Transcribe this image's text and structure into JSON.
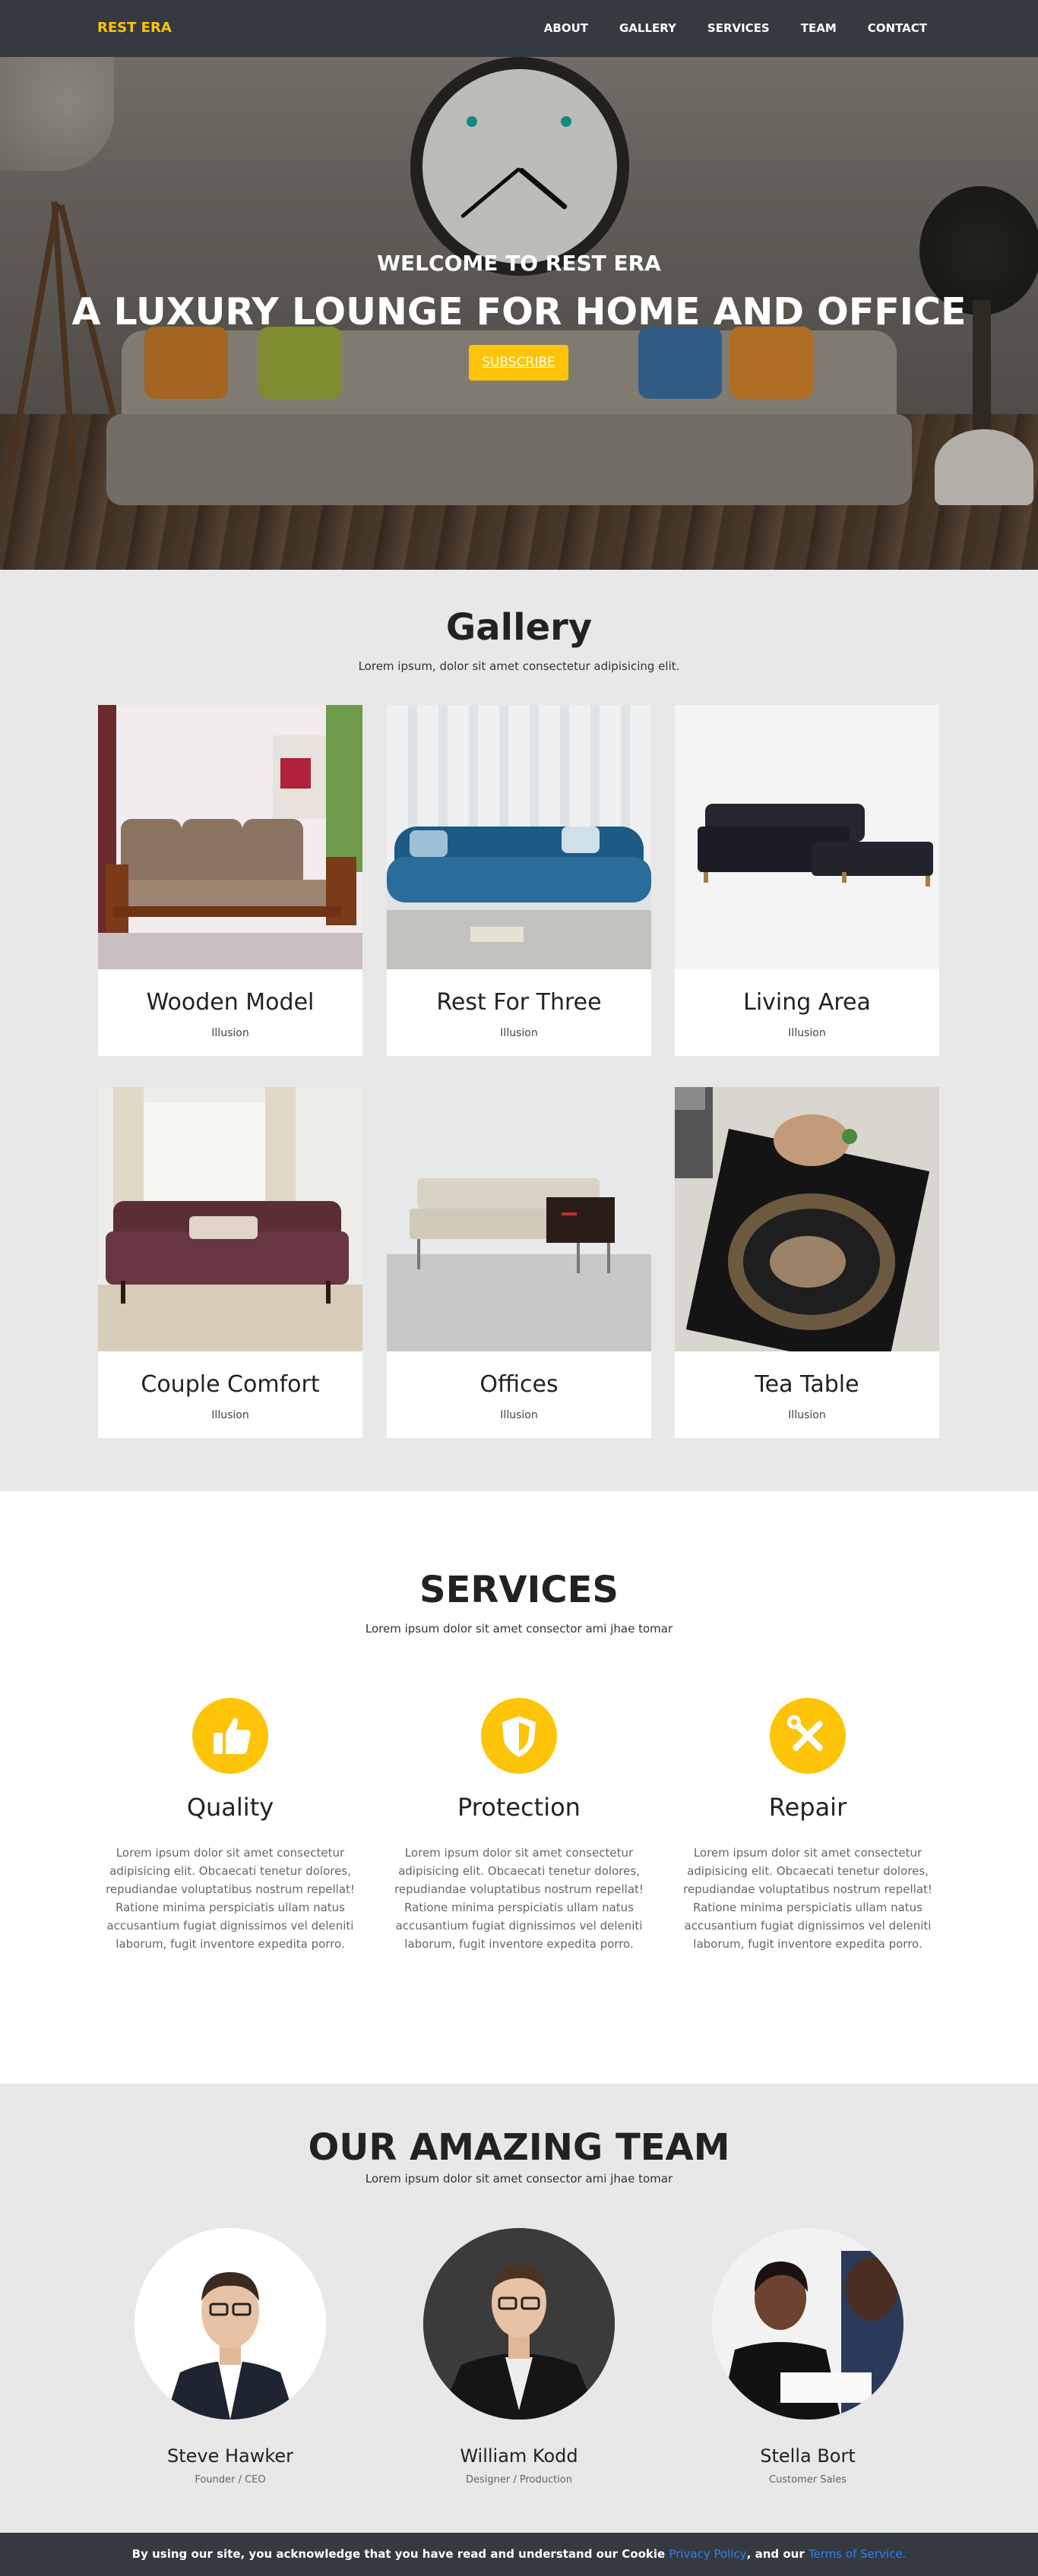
{
  "nav": {
    "brand": "REST ERA",
    "links": [
      "ABOUT",
      "GALLERY",
      "SERVICES",
      "TEAM",
      "CONTACT"
    ]
  },
  "hero": {
    "subtitle": "WELCOME TO REST ERA",
    "title": "A LUXURY LOUNGE FOR HOME AND OFFICE",
    "button": "SUBSCRIBE"
  },
  "gallery": {
    "title": "Gallery",
    "subtitle": "Lorem ipsum, dolor sit amet consectetur adipisicing elit.",
    "items": [
      {
        "title": "Wooden Model",
        "category": "Illusion"
      },
      {
        "title": "Rest For Three",
        "category": "Illusion"
      },
      {
        "title": "Living Area",
        "category": "Illusion"
      },
      {
        "title": "Couple Comfort",
        "category": "Illusion"
      },
      {
        "title": "Offices",
        "category": "Illusion"
      },
      {
        "title": "Tea Table",
        "category": "Illusion"
      }
    ]
  },
  "services": {
    "title": "SERVICES",
    "subtitle": "Lorem ipsum dolor sit amet consector ami jhae tomar",
    "items": [
      {
        "name": "Quality",
        "icon": "thumbs-up-icon",
        "text": "Lorem ipsum dolor sit amet consectetur adipisicing elit. Obcaecati tenetur dolores, repudiandae voluptatibus nostrum repellat! Ratione minima perspiciatis ullam natus accusantium fugiat dignissimos vel deleniti laborum, fugit inventore expedita porro."
      },
      {
        "name": "Protection",
        "icon": "shield-icon",
        "text": "Lorem ipsum dolor sit amet consectetur adipisicing elit. Obcaecati tenetur dolores, repudiandae voluptatibus nostrum repellat! Ratione minima perspiciatis ullam natus accusantium fugiat dignissimos vel deleniti laborum, fugit inventore expedita porro."
      },
      {
        "name": "Repair",
        "icon": "tools-icon",
        "text": "Lorem ipsum dolor sit amet consectetur adipisicing elit. Obcaecati tenetur dolores, repudiandae voluptatibus nostrum repellat! Ratione minima perspiciatis ullam natus accusantium fugiat dignissimos vel deleniti laborum, fugit inventore expedita porro."
      }
    ]
  },
  "team": {
    "title": "OUR AMAZING TEAM",
    "subtitle": "Lorem ipsum dolor sit amet consector ami jhae tomar",
    "members": [
      {
        "name": "Steve Hawker",
        "role": "Founder / CEO"
      },
      {
        "name": "William Kodd",
        "role": "Designer / Production"
      },
      {
        "name": "Stella Bort",
        "role": "Customer Sales"
      }
    ]
  },
  "cookie": {
    "text": "By using our site, you acknowledge that you have read and understand our Cookie",
    "privacy_link": "Privacy Policy",
    "middle": ", and our",
    "terms_link": "Terms of Service."
  },
  "colors": {
    "accent": "#fdc40a",
    "dark": "#343a40",
    "section_bg": "#e8e8e8",
    "link": "#2f7ff5"
  }
}
